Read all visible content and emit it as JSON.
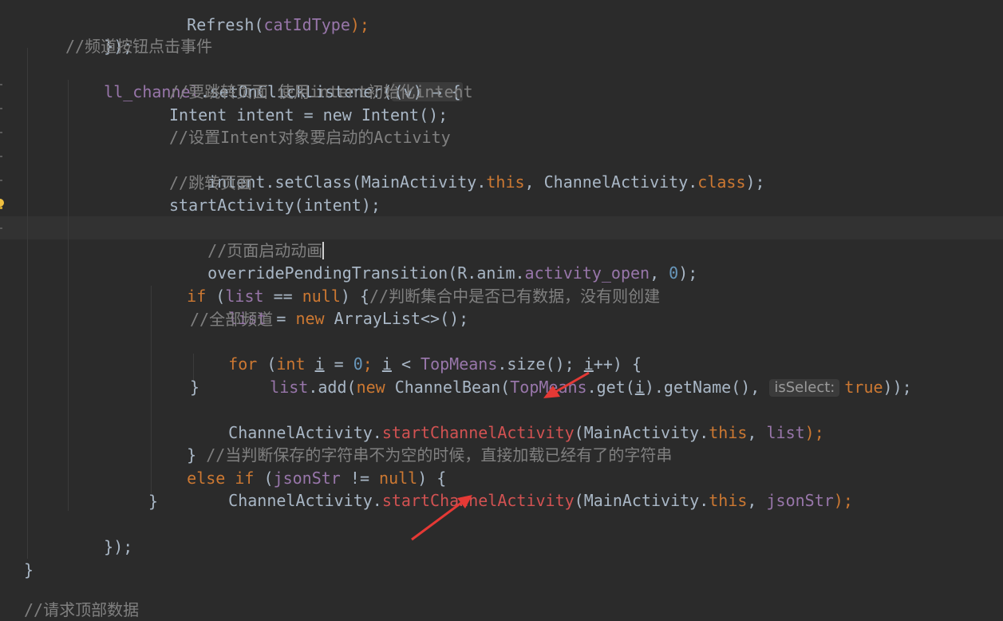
{
  "editor": {
    "lines": {
      "l0": [
        "Refresh(",
        "catIdType",
        ");"
      ],
      "l1": [
        "});"
      ],
      "l2": "//频道按钮点击事件",
      "l3": [
        "ll_channel",
        ".setOnClickListener(",
        "(v) → {"
      ],
      "l4": "//要跳转页面 使用intent初始化intent",
      "l5": "Intent intent = new Intent();",
      "l6": "//设置Intent对象要启动的Activity",
      "l7": [
        "intent.setClass(MainActivity.",
        "this",
        ", ChannelActivity.",
        "class",
        ");"
      ],
      "l8": "//跳转页面",
      "l9": "startActivity(intent);",
      "l10": "//页面启动动画",
      "l11": [
        "overridePendingTransition(R.anim.",
        "activity_open",
        ", ",
        "0",
        ");"
      ],
      "l12": [
        "if",
        " (",
        "list",
        " == ",
        "null",
        ") {",
        "//判断集合中是否已有数据，没有则创建"
      ],
      "l13": [
        "list",
        " = ",
        "new",
        " ArrayList<>();"
      ],
      "l14": "//全部频道",
      "l15": [
        "for",
        " (",
        "int",
        " ",
        "i",
        " = ",
        "0",
        "; ",
        "i",
        " < ",
        "TopMeans",
        ".size(); ",
        "i",
        "++) {"
      ],
      "l16": [
        "list",
        ".add(",
        "new",
        " ChannelBean(",
        "TopMeans",
        ".get(",
        "i",
        ").getName(), ",
        "isSelect:",
        "true",
        "));"
      ],
      "l17": "}",
      "l18": [
        "ChannelActivity.",
        "startChannelActivity",
        "(MainActivity.",
        "this",
        ", ",
        "list",
        ");"
      ],
      "l19": [
        "} ",
        "//当判断保存的字符串不为空的时候，直接加载已经有了的字符串"
      ],
      "l20": [
        "else if",
        " (",
        "jsonStr",
        " != ",
        "null",
        ") {"
      ],
      "l21": [
        "ChannelActivity.",
        "startChannelActivity",
        "(MainActivity.",
        "this",
        ", ",
        "jsonStr",
        ");"
      ],
      "l22": "}",
      "l23": [
        "});"
      ],
      "l24": "}",
      "l25": "//请求顶部数据"
    }
  },
  "colors": {
    "background": "#2b2b2b",
    "keyword": "#cc7832",
    "field": "#9876aa",
    "comment": "#808080",
    "number": "#6897bb",
    "error": "#d25252",
    "annotation_arrow": "#e53935"
  },
  "icons": {
    "intention": "lightbulb-icon",
    "annotation": "red-arrow-icon"
  }
}
